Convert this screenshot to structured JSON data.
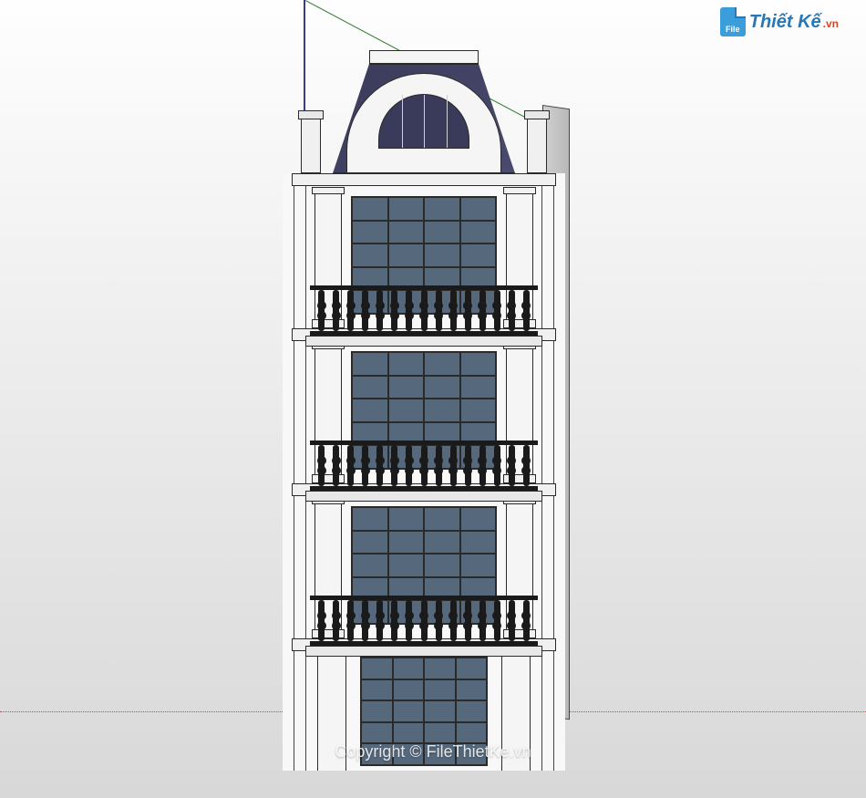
{
  "watermark": {
    "icon_label": "File",
    "brand_main": "Thiết Kế",
    "brand_suffix": ".vn"
  },
  "copyright": "Copyright © FileThietKe.vn"
}
